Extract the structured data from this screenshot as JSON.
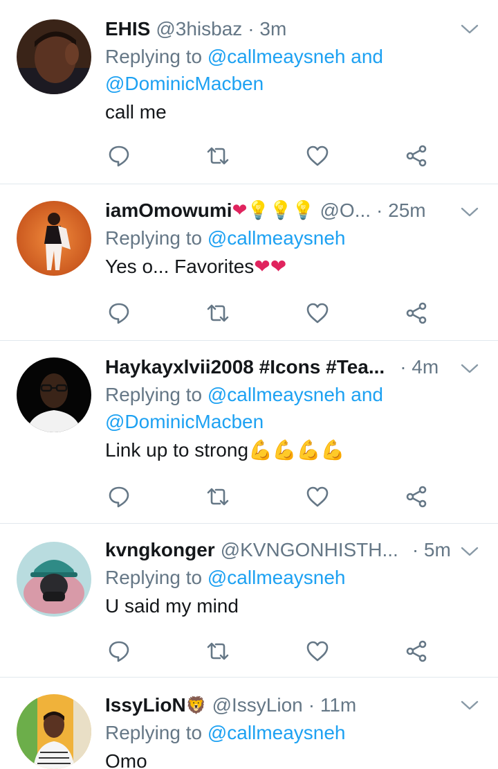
{
  "tweets": [
    {
      "name": "EHIS",
      "name_emoji": "",
      "handle": "@3hisbaz",
      "time": "· 3m",
      "replying_prefix": "Replying to ",
      "reply_to_1": "@callmeaysneh",
      "reply_and": " and",
      "reply_to_2": "@DominicMacben",
      "text": "call me",
      "text_emoji": ""
    },
    {
      "name": "iamOmowumi",
      "name_emoji": "❤💡💡💡",
      "handle": "@O...",
      "time": "· 25m",
      "replying_prefix": "Replying to ",
      "reply_to_1": "@callmeaysneh",
      "text": "Yes o... Favorites",
      "text_emoji": "❤❤"
    },
    {
      "name": "Haykayxlvii2008 #Icons #Tea...",
      "name_emoji": "",
      "handle": "",
      "time": "· 4m",
      "replying_prefix": "Replying to ",
      "reply_to_1": "@callmeaysneh",
      "reply_and": " and",
      "reply_to_2": "@DominicMacben",
      "text": "Link up to strong",
      "text_emoji": "💪💪💪💪"
    },
    {
      "name": "kvngkonger",
      "name_emoji": "",
      "handle": "@KVNGONHISTH...",
      "time": "· 5m",
      "replying_prefix": "Replying to ",
      "reply_to_1": "@callmeaysneh",
      "text": "U said my mind",
      "text_emoji": ""
    },
    {
      "name": "IssyLioN",
      "name_emoji": "🦁",
      "handle": "@IssyLion",
      "time": "· 11m",
      "replying_prefix": "Replying to ",
      "reply_to_1": "@callmeaysneh",
      "text": "Omo",
      "text_emoji": ""
    }
  ],
  "colors": {
    "accent": "#1da1f2",
    "secondary_text": "#657786",
    "primary_text": "#14171a",
    "divider": "#e1e8ed",
    "icon": "#657786"
  },
  "icons": [
    "reply-icon",
    "retweet-icon",
    "like-icon",
    "share-icon",
    "chevron-down-icon"
  ]
}
